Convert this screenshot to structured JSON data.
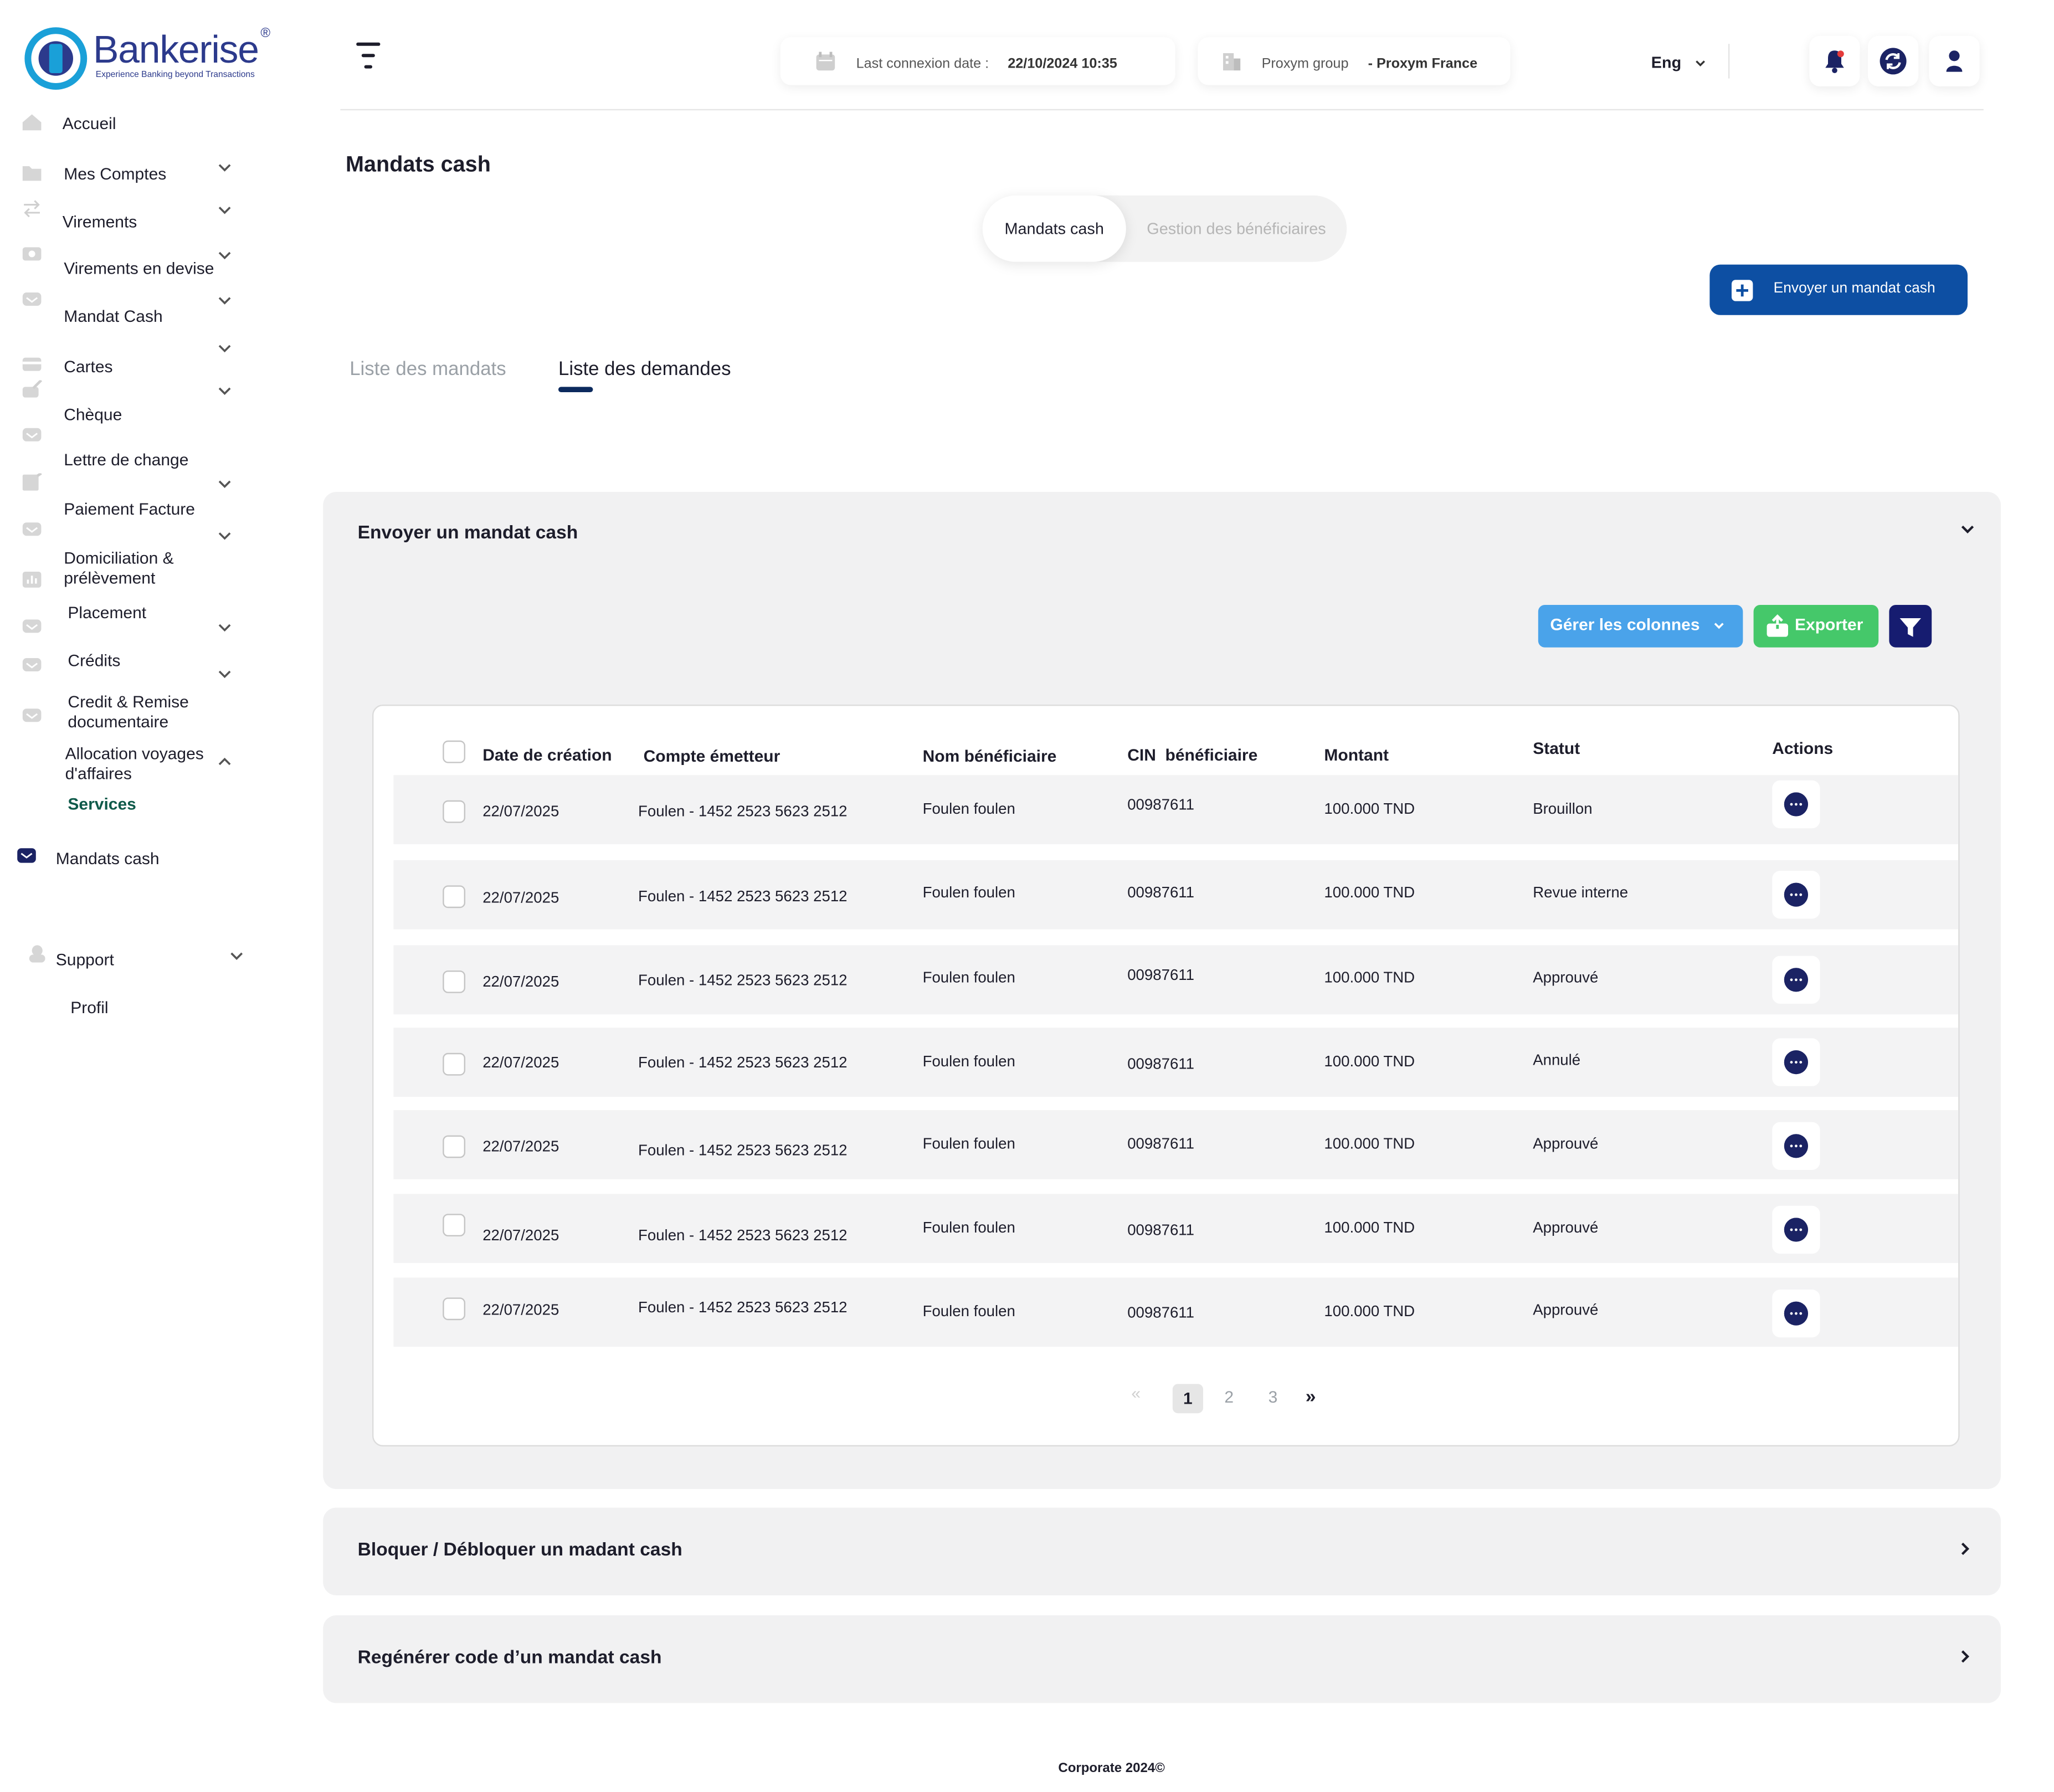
{
  "brand": {
    "name": "Bankerise",
    "registered": "®",
    "tagline": "Experience Banking beyond Transactions"
  },
  "sidebar": {
    "items": [
      {
        "label": "Accueil",
        "icon": "home-icon"
      },
      {
        "label": "Mes Comptes",
        "icon": "folder-icon"
      },
      {
        "label": "Virements",
        "icon": "transfer-icon"
      },
      {
        "label": "Virements en devise",
        "icon": "currency-icon"
      },
      {
        "label": "Mandat Cash",
        "icon": "mail-icon"
      },
      {
        "label": "Cartes",
        "icon": "card-icon"
      },
      {
        "label": "Chèque",
        "icon": "cheque-icon"
      },
      {
        "label": "Lettre de change",
        "icon": "mail-icon"
      },
      {
        "label": "Paiement Facture",
        "icon": "invoice-icon"
      },
      {
        "label": "Domiciliation & prélèvement",
        "icon": "mail-icon"
      },
      {
        "label": "Placement",
        "icon": "chart-icon"
      },
      {
        "label": "Crédits",
        "icon": "mail-icon"
      },
      {
        "label": "Credit & Remise documentaire",
        "icon": "mail-icon"
      },
      {
        "label": "Allocation voyages d'affaires",
        "icon": "mail-icon"
      }
    ],
    "services_label": "Services",
    "active_item": "Mandats cash",
    "support_label": "Support",
    "profil_label": "Profil"
  },
  "header": {
    "last_connexion_label": "Last connexion date :",
    "last_connexion_value": "22/10/2024 10:35",
    "group_label": "Proxym group",
    "group_value": "- Proxym France",
    "language": "Eng"
  },
  "page": {
    "title": "Mandats cash",
    "segments": [
      "Mandats cash",
      "Gestion des bénéficiaires"
    ],
    "send_button": "Envoyer un mandat cash",
    "tabs": [
      "Liste des mandats",
      "Liste des demandes"
    ],
    "active_tab": 1
  },
  "panel_send": {
    "title": "Envoyer un mandat cash",
    "manage_columns": "Gérer les colonnes",
    "export": "Exporter"
  },
  "table": {
    "columns": [
      "Date de création",
      "Compte émetteur",
      "Nom bénéficiaire",
      "CIN  bénéficiaire",
      "Montant",
      "Statut",
      "Actions"
    ],
    "rows": [
      {
        "date": "22/07/2025",
        "account": "Foulen - 1452 2523 5623 2512",
        "name": "Foulen foulen",
        "cin": "00987611",
        "amount": "100.000 TND",
        "status": "Brouillon"
      },
      {
        "date": "22/07/2025",
        "account": "Foulen - 1452 2523 5623 2512",
        "name": "Foulen foulen",
        "cin": "00987611",
        "amount": "100.000 TND",
        "status": "Revue interne"
      },
      {
        "date": "22/07/2025",
        "account": "Foulen - 1452 2523 5623 2512",
        "name": "Foulen foulen",
        "cin": "00987611",
        "amount": "100.000 TND",
        "status": "Approuvé"
      },
      {
        "date": "22/07/2025",
        "account": "Foulen - 1452 2523 5623 2512",
        "name": "Foulen foulen",
        "cin": "00987611",
        "amount": "100.000 TND",
        "status": "Annulé"
      },
      {
        "date": "22/07/2025",
        "account": "Foulen - 1452 2523 5623 2512",
        "name": "Foulen foulen",
        "cin": "00987611",
        "amount": "100.000 TND",
        "status": "Approuvé"
      },
      {
        "date": "22/07/2025",
        "account": "Foulen - 1452 2523 5623 2512",
        "name": "Foulen foulen",
        "cin": "00987611",
        "amount": "100.000 TND",
        "status": "Approuvé"
      },
      {
        "date": "22/07/2025",
        "account": "Foulen - 1452 2523 5623 2512",
        "name": "Foulen foulen",
        "cin": "00987611",
        "amount": "100.000 TND",
        "status": "Approuvé"
      }
    ]
  },
  "pagination": {
    "prev": "«",
    "pages": [
      "1",
      "2",
      "3"
    ],
    "current": "1",
    "next": "»"
  },
  "panel_block": {
    "title": "Bloquer / Débloquer un madant cash"
  },
  "panel_regen": {
    "title": "Regénérer code d’un mandat cash"
  },
  "footer": "Corporate 2024©",
  "colors": {
    "primary": "#0d4fa3",
    "navy": "#1b2364",
    "columns_btn": "#4aa3ea",
    "export_btn": "#45c86a",
    "services": "#0f5a4a"
  }
}
